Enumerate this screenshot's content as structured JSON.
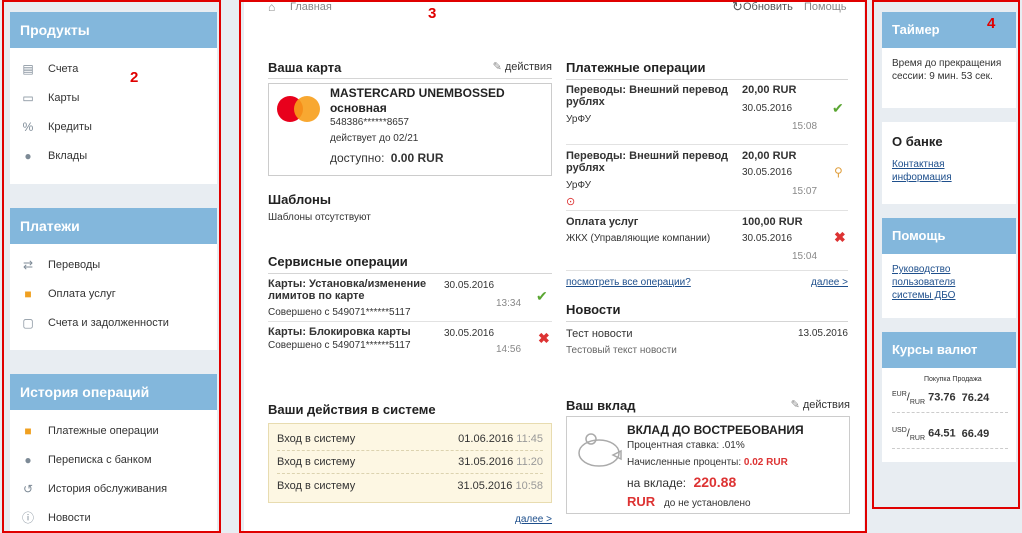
{
  "left": {
    "products": {
      "title": "Продукты",
      "items": [
        {
          "label": "Счета",
          "icon": "accounts-icon"
        },
        {
          "label": "Карты",
          "icon": "card-icon"
        },
        {
          "label": "Кредиты",
          "icon": "percent-icon"
        },
        {
          "label": "Вклады",
          "icon": "piggy-icon"
        }
      ]
    },
    "payments": {
      "title": "Платежи",
      "items": [
        {
          "label": "Переводы",
          "icon": "transfer-icon"
        },
        {
          "label": "Оплата услуг",
          "icon": "services-icon"
        },
        {
          "label": "Счета и задолженности",
          "icon": "invoice-icon"
        }
      ]
    },
    "history": {
      "title": "История операций",
      "items": [
        {
          "label": "Платежные операции",
          "icon": "payments-icon"
        },
        {
          "label": "Переписка с банком",
          "icon": "chat-icon"
        },
        {
          "label": "История обслуживания",
          "icon": "history-icon"
        },
        {
          "label": "Новости",
          "icon": "info-icon"
        }
      ]
    }
  },
  "header": {
    "home": "Главная",
    "refresh": "Обновить",
    "help": "Помощь"
  },
  "card": {
    "title": "Ваша карта",
    "actions": "действия",
    "name": "MASTERCARD UNEMBOSSED",
    "type": "основная",
    "number": "548386******8657",
    "valid": "действует до 02/21",
    "available_label": "доступно:",
    "available_value": "0.00 RUR"
  },
  "templates": {
    "title": "Шаблоны",
    "empty": "Шаблоны отсутствуют"
  },
  "service": {
    "title": "Сервисные операции",
    "items": [
      {
        "name": "Карты: Установка/изменение лимитов по карте",
        "sub": "Совершено с 549071******5117",
        "date": "30.05.2016",
        "time": "13:34",
        "status": "ok"
      },
      {
        "name": "Карты: Блокировка карты",
        "sub": "Совершено с 549071******5117",
        "date": "30.05.2016",
        "time": "14:56",
        "status": "fail"
      }
    ]
  },
  "actions": {
    "title": "Ваши действия в системе",
    "rows": [
      {
        "label": "Вход в систему",
        "date": "01.06.2016",
        "time": "11:45"
      },
      {
        "label": "Вход в систему",
        "date": "31.05.2016",
        "time": "11:20"
      },
      {
        "label": "Вход в систему",
        "date": "31.05.2016",
        "time": "10:58"
      }
    ],
    "more": "далее >"
  },
  "payments_ops": {
    "title": "Платежные операции",
    "items": [
      {
        "name": "Переводы: Внешний перевод рублях",
        "sub": "УрФУ",
        "amount": "20,00 RUR",
        "date": "30.05.2016",
        "time": "15:08",
        "status": "ok"
      },
      {
        "name": "Переводы: Внешний перевод рублях",
        "sub": "УрФУ",
        "amount": "20,00 RUR",
        "date": "30.05.2016",
        "time": "15:07",
        "status": "pending"
      },
      {
        "name": "Оплата услуг",
        "sub": "ЖКХ (Управляющие компании)",
        "amount": "100,00 RUR",
        "date": "30.05.2016",
        "time": "15:04",
        "status": "fail"
      }
    ],
    "see_all": "посмотреть все операции?",
    "more": "далее >"
  },
  "news": {
    "title": "Новости",
    "items": [
      {
        "title": "Тест новости",
        "text": "Тестовый текст новости",
        "date": "13.05.2016"
      }
    ]
  },
  "deposit": {
    "title": "Ваш вклад",
    "actions": "действия",
    "name": "ВКЛАД ДО ВОСТРЕБОВАНИЯ",
    "rate": "Процентная ставка: .01%",
    "accrued_label": "Начисленные проценты:",
    "accrued_value": "0.02 RUR",
    "balance_label": "на вкладе:",
    "balance_value": "220.88",
    "currency": "RUR",
    "not_set": "до не установлено"
  },
  "right": {
    "timer": {
      "title": "Таймер",
      "text": "Время до прекращения сессии: 9 мин. 53 сек."
    },
    "about": {
      "title": "О банке",
      "link": "Контактная информация"
    },
    "help": {
      "title": "Помощь",
      "link": "Руководство пользователя системы ДБО"
    },
    "rates": {
      "title": "Курсы валют",
      "buy": "Покупка",
      "sell": "Продажа",
      "rows": [
        {
          "code": "EUR",
          "base": "RUR",
          "buy": "73.76",
          "sell": "76.24"
        },
        {
          "code": "USD",
          "base": "RUR",
          "buy": "64.51",
          "sell": "66.49"
        }
      ]
    }
  },
  "annotations": {
    "left": "2",
    "center": "3",
    "right": "4"
  },
  "colors": {
    "accent": "#83b7dc",
    "link": "#1e4f8c",
    "red": "#d33",
    "green": "#5aa632"
  }
}
